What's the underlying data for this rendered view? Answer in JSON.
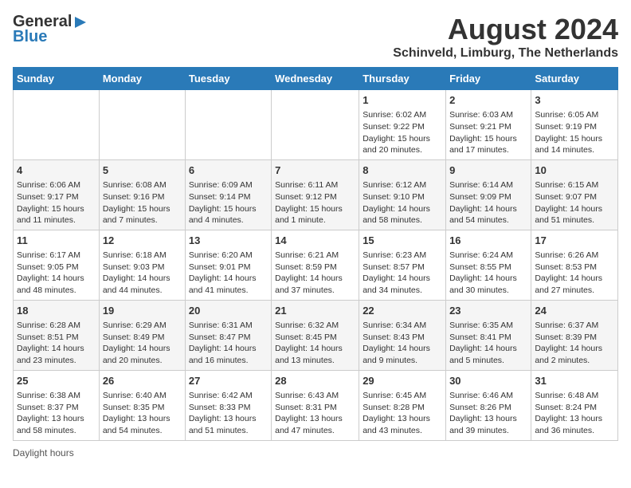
{
  "header": {
    "logo_general": "General",
    "logo_blue": "Blue",
    "month_year": "August 2024",
    "location": "Schinveld, Limburg, The Netherlands"
  },
  "weekdays": [
    "Sunday",
    "Monday",
    "Tuesday",
    "Wednesday",
    "Thursday",
    "Friday",
    "Saturday"
  ],
  "weeks": [
    [
      {
        "day": "",
        "info": ""
      },
      {
        "day": "",
        "info": ""
      },
      {
        "day": "",
        "info": ""
      },
      {
        "day": "",
        "info": ""
      },
      {
        "day": "1",
        "info": "Sunrise: 6:02 AM\nSunset: 9:22 PM\nDaylight: 15 hours and 20 minutes."
      },
      {
        "day": "2",
        "info": "Sunrise: 6:03 AM\nSunset: 9:21 PM\nDaylight: 15 hours and 17 minutes."
      },
      {
        "day": "3",
        "info": "Sunrise: 6:05 AM\nSunset: 9:19 PM\nDaylight: 15 hours and 14 minutes."
      }
    ],
    [
      {
        "day": "4",
        "info": "Sunrise: 6:06 AM\nSunset: 9:17 PM\nDaylight: 15 hours and 11 minutes."
      },
      {
        "day": "5",
        "info": "Sunrise: 6:08 AM\nSunset: 9:16 PM\nDaylight: 15 hours and 7 minutes."
      },
      {
        "day": "6",
        "info": "Sunrise: 6:09 AM\nSunset: 9:14 PM\nDaylight: 15 hours and 4 minutes."
      },
      {
        "day": "7",
        "info": "Sunrise: 6:11 AM\nSunset: 9:12 PM\nDaylight: 15 hours and 1 minute."
      },
      {
        "day": "8",
        "info": "Sunrise: 6:12 AM\nSunset: 9:10 PM\nDaylight: 14 hours and 58 minutes."
      },
      {
        "day": "9",
        "info": "Sunrise: 6:14 AM\nSunset: 9:09 PM\nDaylight: 14 hours and 54 minutes."
      },
      {
        "day": "10",
        "info": "Sunrise: 6:15 AM\nSunset: 9:07 PM\nDaylight: 14 hours and 51 minutes."
      }
    ],
    [
      {
        "day": "11",
        "info": "Sunrise: 6:17 AM\nSunset: 9:05 PM\nDaylight: 14 hours and 48 minutes."
      },
      {
        "day": "12",
        "info": "Sunrise: 6:18 AM\nSunset: 9:03 PM\nDaylight: 14 hours and 44 minutes."
      },
      {
        "day": "13",
        "info": "Sunrise: 6:20 AM\nSunset: 9:01 PM\nDaylight: 14 hours and 41 minutes."
      },
      {
        "day": "14",
        "info": "Sunrise: 6:21 AM\nSunset: 8:59 PM\nDaylight: 14 hours and 37 minutes."
      },
      {
        "day": "15",
        "info": "Sunrise: 6:23 AM\nSunset: 8:57 PM\nDaylight: 14 hours and 34 minutes."
      },
      {
        "day": "16",
        "info": "Sunrise: 6:24 AM\nSunset: 8:55 PM\nDaylight: 14 hours and 30 minutes."
      },
      {
        "day": "17",
        "info": "Sunrise: 6:26 AM\nSunset: 8:53 PM\nDaylight: 14 hours and 27 minutes."
      }
    ],
    [
      {
        "day": "18",
        "info": "Sunrise: 6:28 AM\nSunset: 8:51 PM\nDaylight: 14 hours and 23 minutes."
      },
      {
        "day": "19",
        "info": "Sunrise: 6:29 AM\nSunset: 8:49 PM\nDaylight: 14 hours and 20 minutes."
      },
      {
        "day": "20",
        "info": "Sunrise: 6:31 AM\nSunset: 8:47 PM\nDaylight: 14 hours and 16 minutes."
      },
      {
        "day": "21",
        "info": "Sunrise: 6:32 AM\nSunset: 8:45 PM\nDaylight: 14 hours and 13 minutes."
      },
      {
        "day": "22",
        "info": "Sunrise: 6:34 AM\nSunset: 8:43 PM\nDaylight: 14 hours and 9 minutes."
      },
      {
        "day": "23",
        "info": "Sunrise: 6:35 AM\nSunset: 8:41 PM\nDaylight: 14 hours and 5 minutes."
      },
      {
        "day": "24",
        "info": "Sunrise: 6:37 AM\nSunset: 8:39 PM\nDaylight: 14 hours and 2 minutes."
      }
    ],
    [
      {
        "day": "25",
        "info": "Sunrise: 6:38 AM\nSunset: 8:37 PM\nDaylight: 13 hours and 58 minutes."
      },
      {
        "day": "26",
        "info": "Sunrise: 6:40 AM\nSunset: 8:35 PM\nDaylight: 13 hours and 54 minutes."
      },
      {
        "day": "27",
        "info": "Sunrise: 6:42 AM\nSunset: 8:33 PM\nDaylight: 13 hours and 51 minutes."
      },
      {
        "day": "28",
        "info": "Sunrise: 6:43 AM\nSunset: 8:31 PM\nDaylight: 13 hours and 47 minutes."
      },
      {
        "day": "29",
        "info": "Sunrise: 6:45 AM\nSunset: 8:28 PM\nDaylight: 13 hours and 43 minutes."
      },
      {
        "day": "30",
        "info": "Sunrise: 6:46 AM\nSunset: 8:26 PM\nDaylight: 13 hours and 39 minutes."
      },
      {
        "day": "31",
        "info": "Sunrise: 6:48 AM\nSunset: 8:24 PM\nDaylight: 13 hours and 36 minutes."
      }
    ]
  ],
  "footer": {
    "daylight_label": "Daylight hours"
  }
}
